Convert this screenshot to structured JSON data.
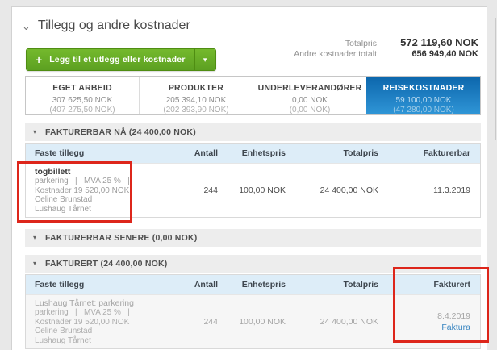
{
  "icons": {
    "collapse_chevron": "⌄",
    "plus": "+",
    "caret_down": "▾",
    "section_arrow": "▾"
  },
  "header": {
    "title": "Tillegg og andre kostnader"
  },
  "toolbar": {
    "add_button_label": "Legg til et utlegg eller kostnader"
  },
  "totals": {
    "rows": [
      {
        "label": "Totalpris",
        "value": "572 119,60 NOK"
      },
      {
        "label": "Andre kostnader totalt",
        "value": "656 949,40 NOK"
      }
    ]
  },
  "tabs": [
    {
      "label": "EGET ARBEID",
      "amount": "307 625,50 NOK",
      "secondary": "(407 275,50 NOK)"
    },
    {
      "label": "PRODUKTER",
      "amount": "205 394,10 NOK",
      "secondary": "(202 393,90 NOK)"
    },
    {
      "label": "UNDERLEVERANDØRER",
      "amount": "0,00 NOK",
      "secondary": "(0,00 NOK)"
    },
    {
      "label": "REISEKOSTNADER",
      "amount": "59 100,00 NOK",
      "secondary": "(47 280,00 NOK)"
    }
  ],
  "sections": {
    "fakturerbar_na": {
      "title": "FAKTURERBAR NÅ (24 400,00 NOK)"
    },
    "fakturerbar_senere": {
      "title": "FAKTURERBAR SENERE (0,00 NOK)"
    },
    "fakturert": {
      "title": "FAKTURERT (24 400,00 NOK)"
    }
  },
  "table1": {
    "headers": {
      "col1": "Faste tillegg",
      "col2": "Antall",
      "col3": "Enhetspris",
      "col4": "Totalpris",
      "col5": "Fakturerbar"
    },
    "row": {
      "name": "togbillett",
      "meta_line1": "parkering   |   MVA 25 %   |",
      "meta_line2": "Kostnader 19 520,00 NOK",
      "meta_line3": "Celine Brunstad",
      "meta_line4": "Lushaug Tårnet",
      "antall": "244",
      "enhetspris": "100,00 NOK",
      "totalpris": "24 400,00 NOK",
      "fakturerbar": "11.3.2019"
    }
  },
  "table2": {
    "headers": {
      "col1": "Faste tillegg",
      "col2": "Antall",
      "col3": "Enhetspris",
      "col4": "Totalpris",
      "col5": "Fakturert"
    },
    "row": {
      "name": "Lushaug Tårnet: parkering",
      "meta_line1": "parkering   |   MVA 25 %   |",
      "meta_line2": "Kostnader 19 520,00 NOK",
      "meta_line3": "Celine Brunstad",
      "meta_line4": "Lushaug Tårnet",
      "antall": "244",
      "enhetspris": "100,00 NOK",
      "totalpris": "24 400,00 NOK",
      "fakturert": "8.4.2019",
      "link": "Faktura"
    }
  },
  "colors": {
    "accent_green": "#65a81e",
    "accent_blue": "#1c80c4",
    "annotation_red": "#dd261b",
    "link_blue": "#3684c0"
  }
}
